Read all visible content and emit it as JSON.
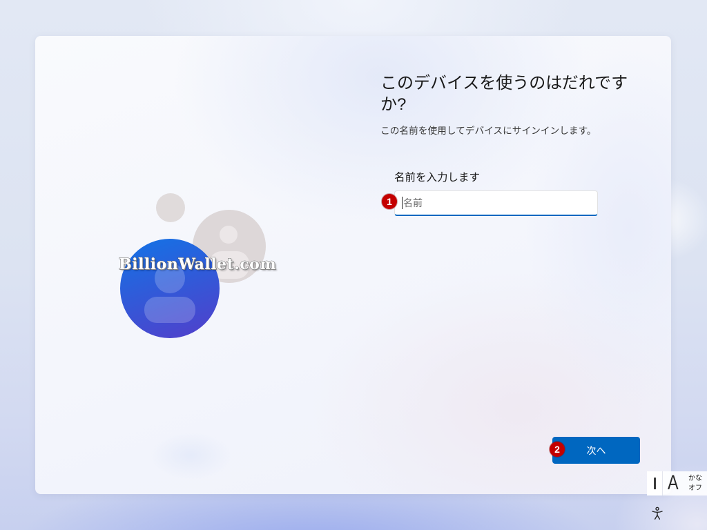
{
  "setup": {
    "title": "このデバイスを使うのはだれですか?",
    "subtitle": "この名前を使用してデバイスにサインインします。",
    "name_field": {
      "label": "名前を入力します",
      "placeholder": "名前",
      "value": ""
    },
    "next_button_label": "次へ"
  },
  "markers": {
    "step_1": "1",
    "step_2": "2"
  },
  "watermark": "BillionWallet.com",
  "ime": {
    "mode": "A",
    "kana_label_top": "かな",
    "kana_label_bottom": "オフ"
  },
  "icons": {
    "illustration": "user-avatar-icon",
    "ime_bar": "ime-bar-icon",
    "accessibility": "accessibility-icon"
  },
  "colors": {
    "accent": "#0067c0",
    "marker": "#c40000",
    "avatar_blue": "#1670e4",
    "avatar_purple": "#4c44cd",
    "avatar_gray": "#ddd7d8"
  }
}
